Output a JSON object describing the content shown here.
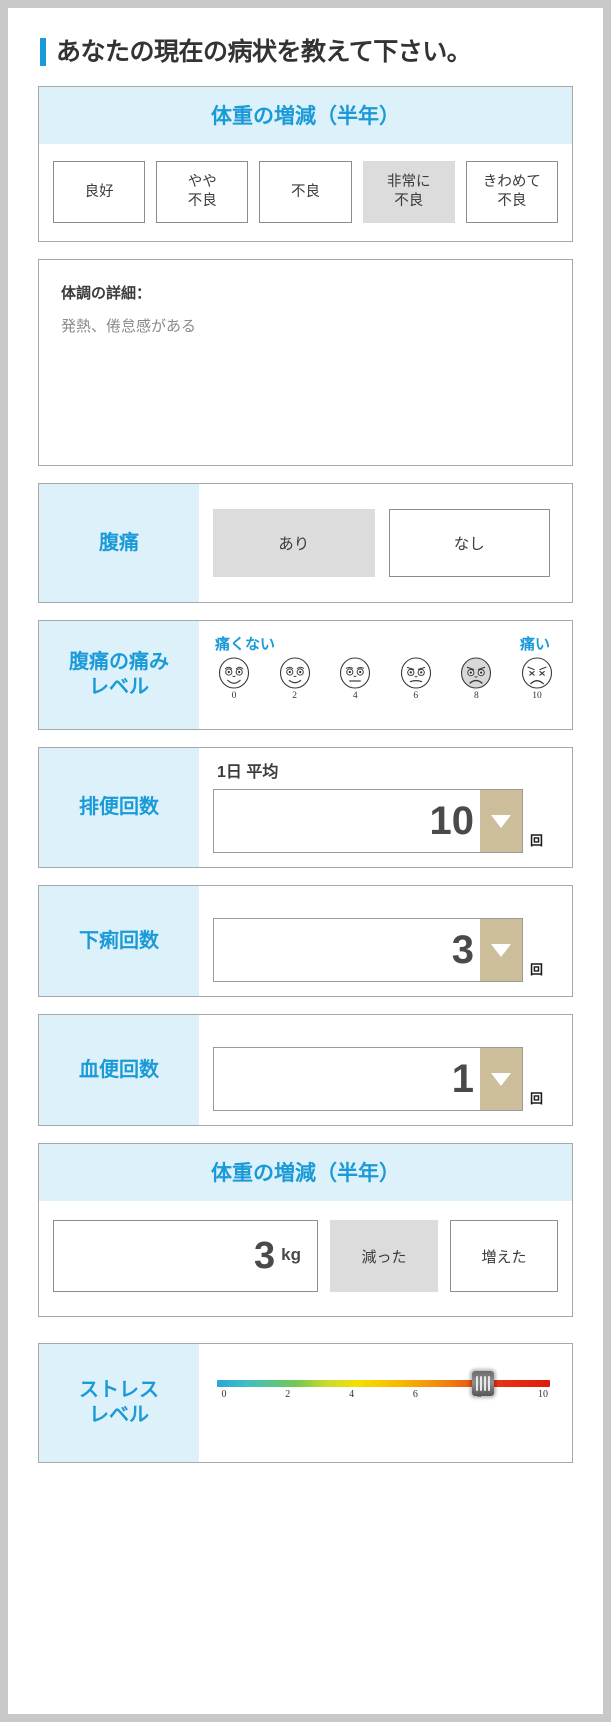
{
  "header": {
    "title": "あなたの現在の病状を教えて下さい。",
    "accent_color": "#1a9ad7"
  },
  "condition_section": {
    "heading": "体重の増減（半年）",
    "options": [
      {
        "label": "良好",
        "selected": false
      },
      {
        "label": "やや\n不良",
        "selected": false
      },
      {
        "label": "不良",
        "selected": false
      },
      {
        "label": "非常に\n不良",
        "selected": true
      },
      {
        "label": "きわめて\n不良",
        "selected": false
      }
    ]
  },
  "memo_section": {
    "label": "体調の詳細：",
    "value": "発熱、倦怠感がある",
    "placeholder": "体調の詳細"
  },
  "abdominal_pain": {
    "label": "腹痛",
    "options": [
      {
        "label": "あり",
        "selected": true
      },
      {
        "label": "なし",
        "selected": false
      }
    ]
  },
  "pain_level": {
    "label": "腹痛の痛み\nレベル",
    "left_end": "痛くない",
    "right_end": "痛い",
    "scale": [
      "0",
      "2",
      "4",
      "6",
      "8",
      "10"
    ],
    "selected_value": "8"
  },
  "bowel_count": {
    "label": "排便回数",
    "avg_label": "1日 平均",
    "value": "10",
    "unit": "回",
    "arrow_color": "#cdbe9b"
  },
  "diarrhea_count": {
    "label": "下痢回数",
    "value": "3",
    "unit": "回"
  },
  "bloody_stool_count": {
    "label": "血便回数",
    "value": "1",
    "unit": "回"
  },
  "weight_change": {
    "heading": "体重の増減（半年）",
    "value": "3",
    "unit": "kg",
    "options": [
      {
        "label": "減った",
        "selected": true
      },
      {
        "label": "増えた",
        "selected": false
      }
    ]
  },
  "stress_level": {
    "label": "ストレス\nレベル",
    "scale": [
      "0",
      "2",
      "4",
      "6",
      "8",
      "10"
    ],
    "value": "8",
    "thumb_percent": 80
  }
}
